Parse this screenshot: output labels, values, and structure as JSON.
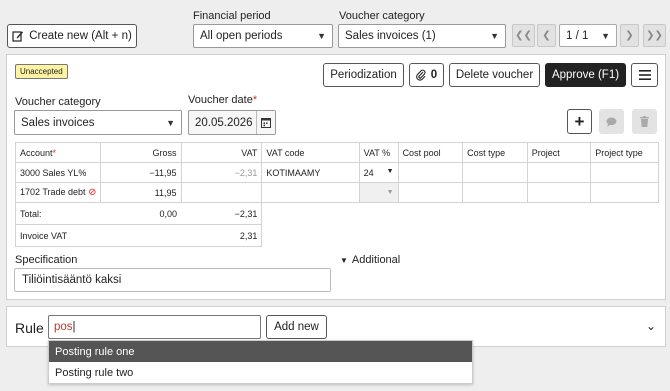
{
  "toolbar": {
    "create_new_label": "Create new (Alt + n)",
    "financial_period_label": "Financial period",
    "financial_period_value": "All open periods",
    "voucher_category_label": "Voucher category",
    "voucher_category_value": "Sales invoices (1)",
    "pager_value": "1 / 1"
  },
  "voucher": {
    "status_badge": "Unaccepted",
    "periodization_label": "Periodization",
    "attachments_count": "0",
    "delete_label": "Delete voucher",
    "approve_label": "Approve (F1)",
    "category_label": "Voucher category",
    "category_value": "Sales invoices",
    "date_label": "Voucher date",
    "date_value": "20.05.2026"
  },
  "table": {
    "headers": {
      "account": "Account",
      "gross": "Gross",
      "vat": "VAT",
      "vat_code": "VAT code",
      "vat_pct": "VAT %",
      "cost_pool": "Cost pool",
      "cost_type": "Cost type",
      "project": "Project",
      "project_type": "Project type"
    },
    "rows": [
      {
        "account": "3000 Sales YL%",
        "gross": "−11,95",
        "vat": "−2,31",
        "vat_code": "KOTIMAAMY",
        "vat_pct": "24"
      },
      {
        "account": "1702 Trade debt",
        "gross": "11,95",
        "vat": "",
        "vat_code": "",
        "vat_pct": ""
      }
    ],
    "total_label": "Total:",
    "total_gross": "0,00",
    "total_vat": "−2,31",
    "invoice_vat_label": "Invoice VAT",
    "invoice_vat_value": "2,31"
  },
  "specification": {
    "label": "Specification",
    "value": "Tiliöintisääntö kaksi",
    "additional_label": "Additional"
  },
  "rule": {
    "label": "Rule",
    "input_value": "pos",
    "add_new_label": "Add new",
    "suggestions": [
      "Posting rule one",
      "Posting rule two"
    ]
  },
  "colors": {
    "badge_bg": "#fff4a3",
    "dark_button": "#222222",
    "required": "#c0392b"
  }
}
